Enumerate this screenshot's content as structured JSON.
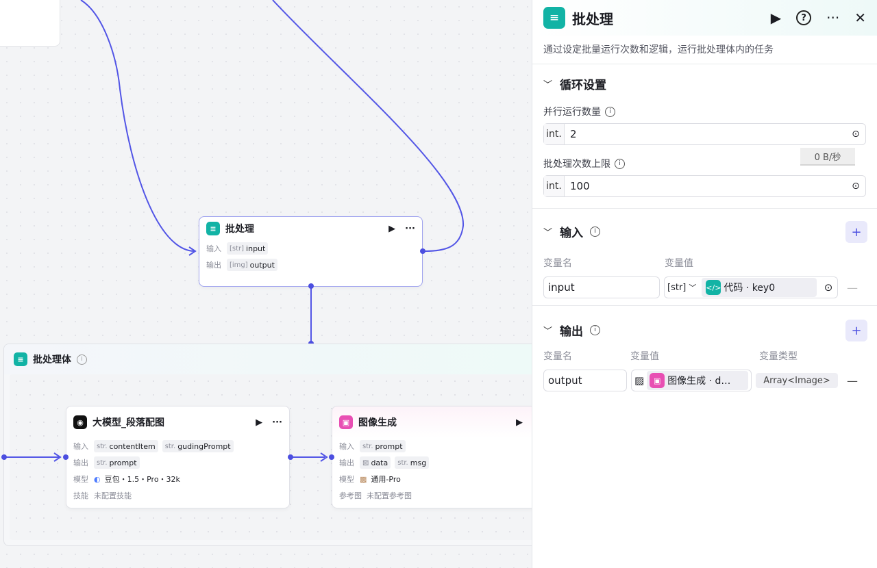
{
  "canvas": {
    "batch_node": {
      "title": "批处理",
      "in_label": "输入",
      "out_label": "输出",
      "in_type": "[str]",
      "in_var": "input",
      "out_type": "[img]",
      "out_var": "output"
    },
    "group": {
      "title": "批处理体"
    },
    "llm_node": {
      "title": "大模型_段落配图",
      "in_label": "输入",
      "out_label": "输出",
      "model_label": "模型",
      "skill_label": "技能",
      "in_vars": [
        {
          "type": "str.",
          "name": "contentItem"
        },
        {
          "type": "str.",
          "name": "gudingPrompt"
        }
      ],
      "out_vars": [
        {
          "type": "str.",
          "name": "prompt"
        }
      ],
      "model": "豆包・1.5・Pro・32k",
      "skill": "未配置技能"
    },
    "img_node": {
      "title": "图像生成",
      "in_label": "输入",
      "out_label": "输出",
      "model_label": "模型",
      "ref_label": "参考图",
      "in_vars": [
        {
          "type": "str.",
          "name": "prompt"
        }
      ],
      "out_vars": [
        {
          "type": "img",
          "name": "data"
        },
        {
          "type": "str.",
          "name": "msg"
        }
      ],
      "model": "通用-Pro",
      "ref": "未配置参考图"
    }
  },
  "panel": {
    "title": "批处理",
    "description": "通过设定批量运行次数和逻辑，运行批处理体内的任务",
    "loop": {
      "title": "循环设置",
      "speed_badge": "0 B/秒",
      "parallel": {
        "label": "并行运行数量",
        "prefix": "int.",
        "value": "2"
      },
      "limit": {
        "label": "批处理次数上限",
        "prefix": "int.",
        "value": "100"
      }
    },
    "input": {
      "title": "输入",
      "col_name": "变量名",
      "col_value": "变量值",
      "rows": [
        {
          "name": "input",
          "type": "[str]",
          "ref": "代码 · key0"
        }
      ]
    },
    "output": {
      "title": "输出",
      "col_name": "变量名",
      "col_value": "变量值",
      "col_type": "变量类型",
      "rows": [
        {
          "name": "output",
          "ref": "图像生成 · d…",
          "vtype": "Array<Image>"
        }
      ]
    }
  },
  "colors": {
    "accent": "#4c4fe0",
    "teal": "#12b3a5",
    "pink": "#e84fb3"
  }
}
